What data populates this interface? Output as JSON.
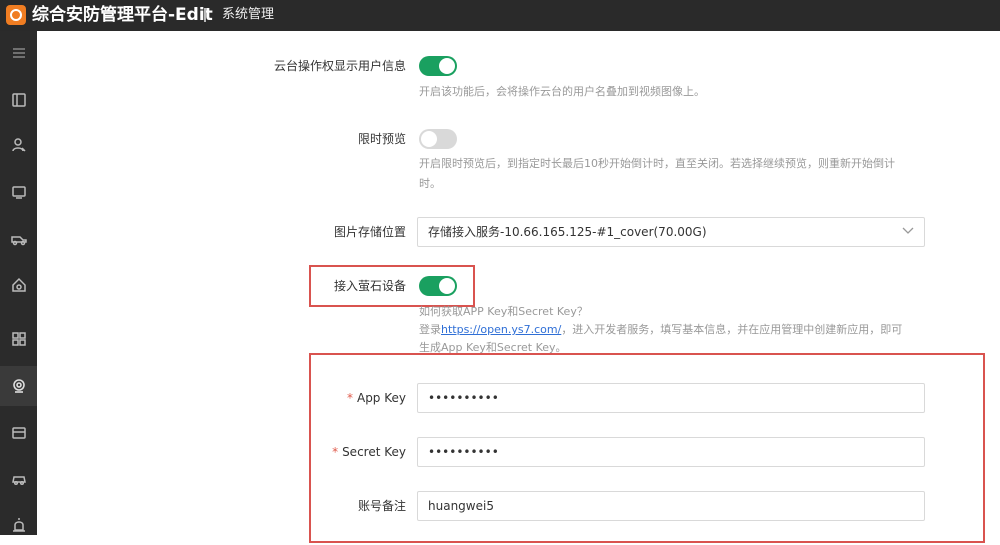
{
  "header": {
    "app_title": "综合安防管理平台-Edit",
    "section": "系统管理"
  },
  "sidebar": {
    "items": [
      {
        "icon": "menu-icon"
      },
      {
        "icon": "device-panel-icon"
      },
      {
        "icon": "person-icon"
      },
      {
        "icon": "monitor-icon"
      },
      {
        "icon": "vehicle-icon"
      },
      {
        "icon": "home-shield-icon"
      },
      {
        "icon": "grid-icon"
      },
      {
        "icon": "camera-icon",
        "active": true
      },
      {
        "icon": "card-icon"
      },
      {
        "icon": "car-icon"
      },
      {
        "icon": "alarm-icon"
      }
    ]
  },
  "form": {
    "ptz_user": {
      "label": "云台操作权显示用户信息",
      "enabled": true,
      "hint": "开启该功能后，会将操作云台的用户名叠加到视频图像上。"
    },
    "timed_preview": {
      "label": "限时预览",
      "enabled": false,
      "hint_line1": "开启限时预览后，到指定时长最后10秒开始倒计时，直至关闭。若选择继续预览，则重新开始倒计",
      "hint_line2": "时。"
    },
    "image_storage": {
      "label": "图片存储位置",
      "value": "存储接入服务-10.66.165.125-#1_cover(70.00G)"
    },
    "ezviz": {
      "label": "接入萤石设备",
      "enabled": true,
      "hint_line1": "如何获取APP Key和Secret Key？",
      "hint_line2_prefix": "登录",
      "hint_link": "https://open.ys7.com/",
      "hint_line2_suffix": "，进入开发者服务，填写基本信息，并在应用管理中创建新应用，即可",
      "hint_line3": "生成App Key和Secret Key。"
    },
    "app_key": {
      "required_mark": "*",
      "label": "App Key",
      "value": "••••••••••"
    },
    "secret_key": {
      "required_mark": "*",
      "label": "Secret Key",
      "value": "••••••••••"
    },
    "account_note": {
      "label": "账号备注",
      "value": "huangwei5"
    }
  },
  "colors": {
    "toggle_on": "#1aa060",
    "highlight_box": "#d9534f",
    "logo": "#f07d22"
  }
}
